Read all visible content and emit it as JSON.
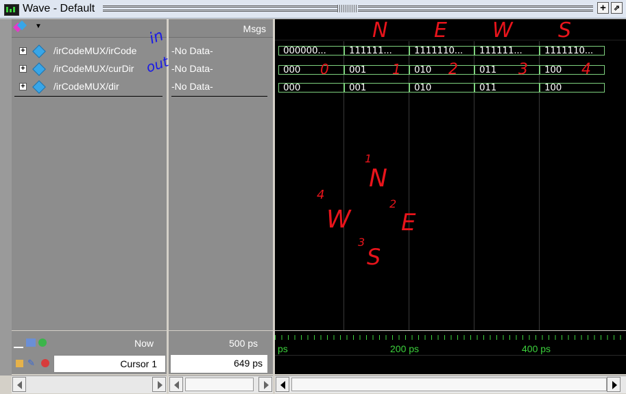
{
  "window": {
    "title": "Wave - Default"
  },
  "signals": [
    {
      "name": "/irCodeMUX/irCode",
      "msg": "-No Data-"
    },
    {
      "name": "/irCodeMUX/curDir",
      "msg": "-No Data-"
    },
    {
      "name": "/irCodeMUX/dir",
      "msg": "-No Data-"
    }
  ],
  "header": {
    "msgs_label": "Msgs"
  },
  "waves": {
    "irCode": [
      "000000...",
      "111111...",
      "1111110...",
      "111111...",
      "1111110..."
    ],
    "curDir": [
      "000",
      "001",
      "010",
      "011",
      "100"
    ],
    "dir": [
      "000",
      "001",
      "010",
      "011",
      "100"
    ]
  },
  "status": {
    "now_label": "Now",
    "now_value": "500 ps",
    "cursor_label": "Cursor 1",
    "cursor_value": "649 ps"
  },
  "timeline": {
    "labels": [
      "ps",
      "200 ps",
      "400 ps"
    ]
  },
  "annotations": {
    "in": "in",
    "out": "out",
    "top_letters": [
      "N",
      "E",
      "W",
      "S"
    ],
    "row_digits": [
      "0",
      "1",
      "2",
      "3",
      "4"
    ],
    "compass": {
      "n": "N",
      "e": "E",
      "w": "W",
      "s": "S",
      "n_num": "1",
      "e_num": "2",
      "s_num": "3",
      "w_num": "4"
    }
  },
  "colors": {
    "wave_bg": "#000000",
    "bus_green": "#7fd27f",
    "time_green": "#3cd23c",
    "ink_red": "#e8141b",
    "ink_blue": "#1a1ae6"
  }
}
